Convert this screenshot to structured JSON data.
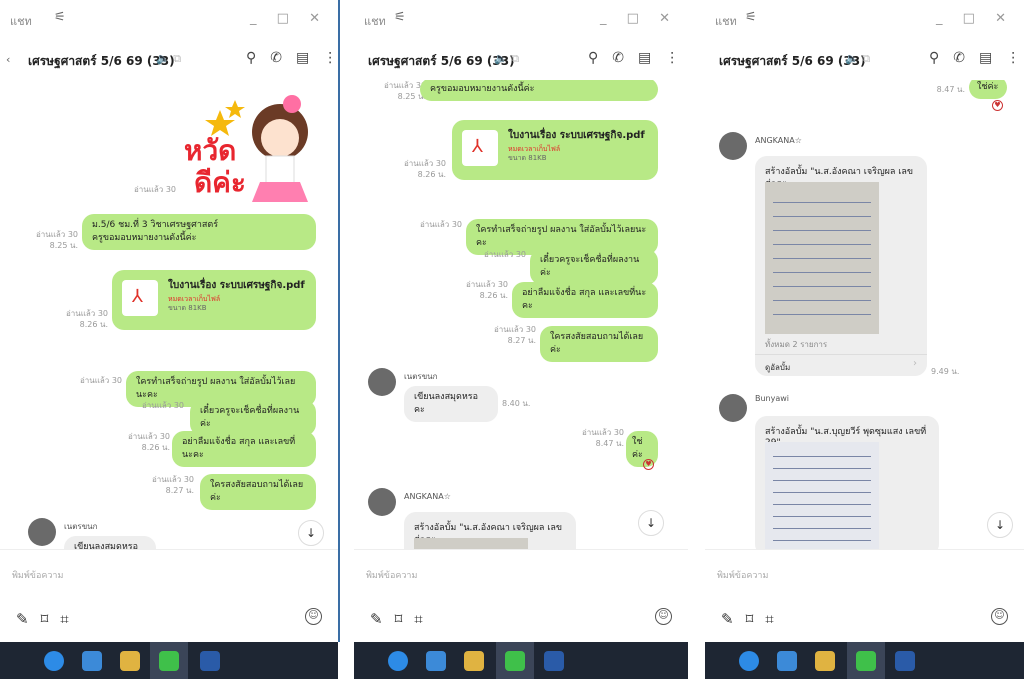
{
  "window": {
    "tab_label": "แชท",
    "controls": "_ □ ✕"
  },
  "chat": {
    "title": "เศรษฐศาสตร์ 5/6 69 (33)",
    "input_placeholder": "พิมพ์ข้อความ"
  },
  "meta": {
    "read30": "อ่านแล้ว 30",
    "t825": "8.25 น.",
    "t826": "8.26 น.",
    "t827": "8.27 น.",
    "t840": "8.40 น.",
    "t847": "8.47 น.",
    "t949": "9.49 น."
  },
  "sticker": {
    "text1": "หวัด",
    "text2": "ดีค่ะ"
  },
  "messages": {
    "assign_line1": "ม.5/6 ชม.ที่ 3  วิชาเศรษฐศาสตร์",
    "assign_line2": "ครูขอมอบหมายงานดังนี้ค่ะ",
    "pdf_name": "ใบงานเรื่อง  ระบบเศรษฐกิจ.pdf",
    "pdf_expired": "หมดเวลาเก็บไฟล์",
    "pdf_size": "ขนาด 81KB",
    "photo_album": "ใครทำเสร็จถ่ายรูป ผลงาน ใส่อัลบั้มไว้เลยนะคะ",
    "write_name": "เดี๋ยวครูจะเช็คชื่อที่ผลงานค่ะ",
    "remind": "อย่าลืมแจ้งชื่อ สกุล และเลขที่นะคะ",
    "ask": "ใครสงสัยสอบถามได้เลยค่ะ",
    "student_msg": "เขียนลงสมุดหรอคะ",
    "yes": "ใช่ค่ะ"
  },
  "users": {
    "u1": "เนตรขนก",
    "u2": "ANGKANA☆",
    "u3": "Bunyawi"
  },
  "albums": {
    "a1_title": "สร้างอัลบั้ม \"น.ส.อังคณา เจริญผล เลขที่35\"",
    "a1_total": "ทั้งหมด 2 รายการ",
    "a1_open": "ดูอัลบั้ม",
    "a2_title": "สร้างอัลบั้ม \"น.ส.บุญยวีร์ พุดซุมแสง เลขที่ 29\""
  },
  "icons": {
    "filter": "sliders-icon",
    "search": "search-icon",
    "phone": "phone-icon",
    "notes": "notes-icon",
    "more": "more-icon",
    "attach": "paperclip-icon",
    "bookmark": "bookmark-icon",
    "crop": "crop-icon",
    "emoji": "emoji-icon",
    "scroll": "arrow-down-icon",
    "back": "chevron-left-icon"
  },
  "colors": {
    "bubble_own": "#b8e986",
    "bubble_other": "#eeeeee",
    "taskbar": "#1e2633"
  }
}
